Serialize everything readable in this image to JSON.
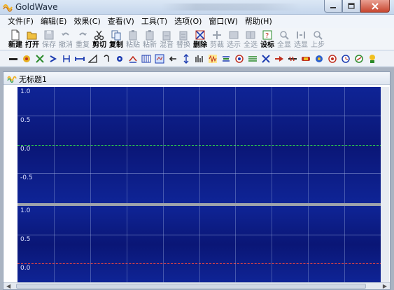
{
  "window": {
    "title": "GoldWave"
  },
  "menu": [
    "文件(F)",
    "编辑(E)",
    "效果(C)",
    "查看(V)",
    "工具(T)",
    "选项(O)",
    "窗口(W)",
    "帮助(H)"
  ],
  "toolbar": [
    {
      "label": "新建",
      "enabled": true,
      "icon": "new-file-icon"
    },
    {
      "label": "打开",
      "enabled": true,
      "icon": "open-folder-icon"
    },
    {
      "label": "保存",
      "enabled": false,
      "icon": "save-icon"
    },
    {
      "label": "撤消",
      "enabled": false,
      "icon": "undo-icon"
    },
    {
      "label": "重复",
      "enabled": false,
      "icon": "redo-icon"
    },
    {
      "label": "剪切",
      "enabled": true,
      "icon": "cut-icon"
    },
    {
      "label": "复制",
      "enabled": true,
      "icon": "copy-icon"
    },
    {
      "label": "粘贴",
      "enabled": false,
      "icon": "paste-icon"
    },
    {
      "label": "粘新",
      "enabled": false,
      "icon": "paste-new-icon"
    },
    {
      "label": "混音",
      "enabled": false,
      "icon": "mix-icon"
    },
    {
      "label": "替换",
      "enabled": false,
      "icon": "replace-icon"
    },
    {
      "label": "删除",
      "enabled": true,
      "icon": "delete-icon"
    },
    {
      "label": "剪裁",
      "enabled": false,
      "icon": "trim-icon"
    },
    {
      "label": "选示",
      "enabled": false,
      "icon": "select-view-icon"
    },
    {
      "label": "全选",
      "enabled": false,
      "icon": "select-all-icon"
    },
    {
      "label": "设标",
      "enabled": true,
      "icon": "set-marker-icon"
    },
    {
      "label": "全显",
      "enabled": false,
      "icon": "show-all-icon"
    },
    {
      "label": "选显",
      "enabled": false,
      "icon": "zoom-selection-icon"
    },
    {
      "label": "上步",
      "enabled": false,
      "icon": "previous-icon"
    }
  ],
  "document": {
    "title": "无标题1",
    "channel1_labels": [
      "1.0",
      "0.5",
      "0.0",
      "-0.5"
    ],
    "channel2_labels": [
      "1.0",
      "0.5",
      "0.0"
    ]
  },
  "colors": {
    "wave_bg": "#0b1a7c",
    "left_zero": "#2fd34a",
    "right_zero": "#ff4a3a"
  }
}
